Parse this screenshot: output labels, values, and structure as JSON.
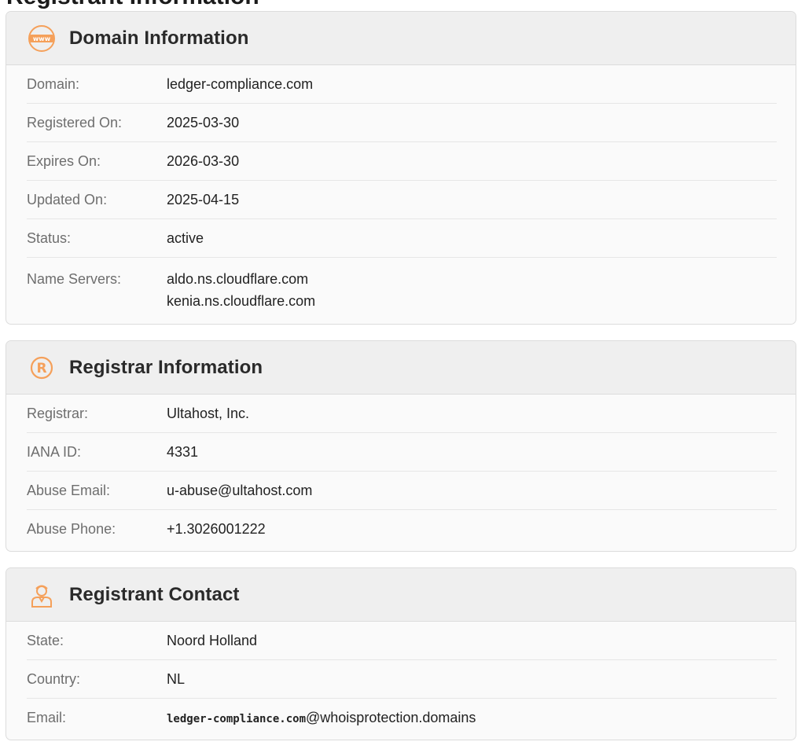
{
  "page": {
    "heading": "Registrant Information"
  },
  "colors": {
    "accent": "#f5a05a",
    "header_bg": "#efefef",
    "label": "#6e6e6e"
  },
  "domain_info": {
    "title": "Domain Information",
    "icon": "www-globe-icon",
    "rows": [
      {
        "label": "Domain:",
        "value": "ledger-compliance.com"
      },
      {
        "label": "Registered On:",
        "value": "2025-03-30"
      },
      {
        "label": "Expires On:",
        "value": "2026-03-30"
      },
      {
        "label": "Updated On:",
        "value": "2025-04-15"
      },
      {
        "label": "Status:",
        "value": "active"
      }
    ],
    "name_servers_label": "Name Servers:",
    "name_servers": [
      "aldo.ns.cloudflare.com",
      "kenia.ns.cloudflare.com"
    ]
  },
  "registrar_info": {
    "title": "Registrar Information",
    "icon": "registered-mark-icon",
    "rows": [
      {
        "label": "Registrar:",
        "value": "Ultahost, Inc."
      },
      {
        "label": "IANA ID:",
        "value": "4331"
      },
      {
        "label": "Abuse Email:",
        "value": "u-abuse@ultahost.com"
      },
      {
        "label": "Abuse Phone:",
        "value": "+1.3026001222"
      }
    ]
  },
  "registrant_contact": {
    "title": "Registrant Contact",
    "icon": "person-icon",
    "rows": [
      {
        "label": "State:",
        "value": "Noord Holland"
      },
      {
        "label": "Country:",
        "value": "NL"
      }
    ],
    "email_label": "Email:",
    "email_user": "ledger-compliance.com",
    "email_domain": "@whoisprotection.domains"
  }
}
